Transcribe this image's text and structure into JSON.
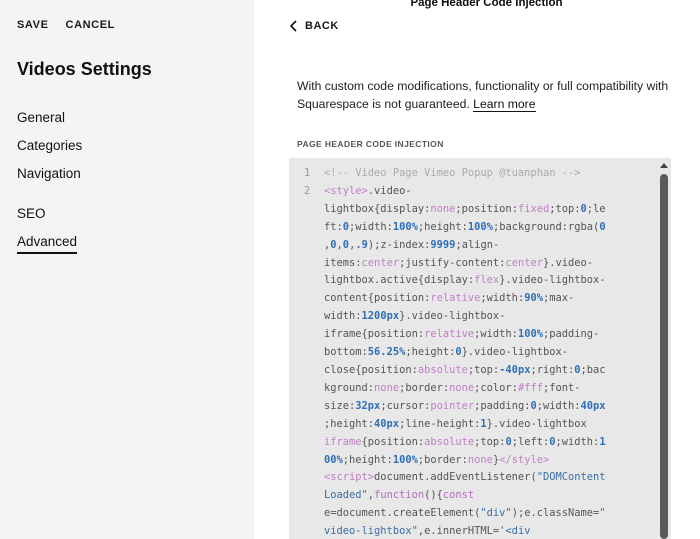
{
  "left_panel": {
    "save_label": "SAVE",
    "cancel_label": "CANCEL",
    "title": "Videos Settings",
    "nav": [
      {
        "label": "General",
        "active": false
      },
      {
        "label": "Categories",
        "active": false
      },
      {
        "label": "Navigation",
        "active": false
      },
      {
        "label": "SEO",
        "active": false
      },
      {
        "label": "Advanced",
        "active": true
      }
    ]
  },
  "right_panel": {
    "title": "Page Header Code Injection",
    "back_label": "BACK",
    "description_text": "With custom code modifications, functionality or full compatibility with Squarespace is not guaranteed.",
    "learn_more": "Learn more",
    "section_label": "PAGE HEADER CODE INJECTION"
  },
  "editor": {
    "line_numbers": [
      "1",
      "2"
    ],
    "code_lines": [
      [
        [
          "c",
          "<!-- Video Page Vimeo Popup @tuanphan -->"
        ]
      ],
      [
        [
          "t",
          "<style>"
        ],
        [
          "p",
          ".video-"
        ]
      ],
      [
        [
          "p",
          "lightbox{display:"
        ],
        [
          "v",
          "none"
        ],
        [
          "p",
          ";position:"
        ],
        [
          "v",
          "fixed"
        ],
        [
          "p",
          ";top:"
        ],
        [
          "n",
          "0"
        ],
        [
          "p",
          ";le"
        ]
      ],
      [
        [
          "p",
          "ft:"
        ],
        [
          "n",
          "0"
        ],
        [
          "p",
          ";width:"
        ],
        [
          "n",
          "100%"
        ],
        [
          "p",
          ";height:"
        ],
        [
          "n",
          "100%"
        ],
        [
          "p",
          ";background:rgba("
        ],
        [
          "n",
          "0"
        ]
      ],
      [
        [
          "p",
          ","
        ],
        [
          "n",
          "0"
        ],
        [
          "p",
          ","
        ],
        [
          "n",
          "0"
        ],
        [
          "p",
          ","
        ],
        [
          "n",
          ".9"
        ],
        [
          "p",
          ");z-index:"
        ],
        [
          "n",
          "9999"
        ],
        [
          "p",
          ";align-"
        ]
      ],
      [
        [
          "p",
          "items:"
        ],
        [
          "v",
          "center"
        ],
        [
          "p",
          ";justify-content:"
        ],
        [
          "v",
          "center"
        ],
        [
          "p",
          "}.video-"
        ]
      ],
      [
        [
          "p",
          "lightbox.active{display:"
        ],
        [
          "v",
          "flex"
        ],
        [
          "p",
          "}.video-lightbox-"
        ]
      ],
      [
        [
          "p",
          "content{position:"
        ],
        [
          "v",
          "relative"
        ],
        [
          "p",
          ";width:"
        ],
        [
          "n",
          "90%"
        ],
        [
          "p",
          ";max-"
        ]
      ],
      [
        [
          "p",
          "width:"
        ],
        [
          "n",
          "1200px"
        ],
        [
          "p",
          "}.video-lightbox-"
        ]
      ],
      [
        [
          "p",
          "iframe{position:"
        ],
        [
          "v",
          "relative"
        ],
        [
          "p",
          ";width:"
        ],
        [
          "n",
          "100%"
        ],
        [
          "p",
          ";padding-"
        ]
      ],
      [
        [
          "p",
          "bottom:"
        ],
        [
          "n",
          "56.25%"
        ],
        [
          "p",
          ";height:"
        ],
        [
          "n",
          "0"
        ],
        [
          "p",
          "}.video-lightbox-"
        ]
      ],
      [
        [
          "p",
          "close{position:"
        ],
        [
          "v",
          "absolute"
        ],
        [
          "p",
          ";top:"
        ],
        [
          "n",
          "-40px"
        ],
        [
          "p",
          ";right:"
        ],
        [
          "n",
          "0"
        ],
        [
          "p",
          ";bac"
        ]
      ],
      [
        [
          "p",
          "kground:"
        ],
        [
          "v",
          "none"
        ],
        [
          "p",
          ";border:"
        ],
        [
          "v",
          "none"
        ],
        [
          "p",
          ";color:"
        ],
        [
          "v",
          "#fff"
        ],
        [
          "p",
          ";font-"
        ]
      ],
      [
        [
          "p",
          "size:"
        ],
        [
          "n",
          "32px"
        ],
        [
          "p",
          ";cursor:"
        ],
        [
          "v",
          "pointer"
        ],
        [
          "p",
          ";padding:"
        ],
        [
          "n",
          "0"
        ],
        [
          "p",
          ";width:"
        ],
        [
          "n",
          "40px"
        ]
      ],
      [
        [
          "p",
          ";height:"
        ],
        [
          "n",
          "40px"
        ],
        [
          "p",
          ";line-height:"
        ],
        [
          "n",
          "1"
        ],
        [
          "p",
          "}.video-lightbox"
        ]
      ],
      [
        [
          "v",
          "iframe"
        ],
        [
          "p",
          "{position:"
        ],
        [
          "v",
          "absolute"
        ],
        [
          "p",
          ";top:"
        ],
        [
          "n",
          "0"
        ],
        [
          "p",
          ";left:"
        ],
        [
          "n",
          "0"
        ],
        [
          "p",
          ";width:"
        ],
        [
          "n",
          "1"
        ]
      ],
      [
        [
          "n",
          "00%"
        ],
        [
          "p",
          ";height:"
        ],
        [
          "n",
          "100%"
        ],
        [
          "p",
          ";border:"
        ],
        [
          "v",
          "none"
        ],
        [
          "p",
          "}"
        ],
        [
          "t",
          "</style>"
        ]
      ],
      [
        [
          "t",
          "<script>"
        ],
        [
          "p",
          "document.addEventListener("
        ],
        [
          "s",
          "\"DOMContent"
        ]
      ],
      [
        [
          "s",
          "Loaded\""
        ],
        [
          "p",
          ","
        ],
        [
          "k",
          "function"
        ],
        [
          "p",
          "(){"
        ],
        [
          "k",
          "const"
        ]
      ],
      [
        [
          "p",
          "e=document.createElement("
        ],
        [
          "s",
          "\"div\""
        ],
        [
          "p",
          ");e.className="
        ],
        [
          "s",
          "\""
        ]
      ],
      [
        [
          "s",
          "video-lightbox\""
        ],
        [
          "p",
          ",e.innerHTML="
        ],
        [
          "s",
          "'<div"
        ]
      ]
    ],
    "line_number_rows": [
      0,
      1
    ]
  }
}
